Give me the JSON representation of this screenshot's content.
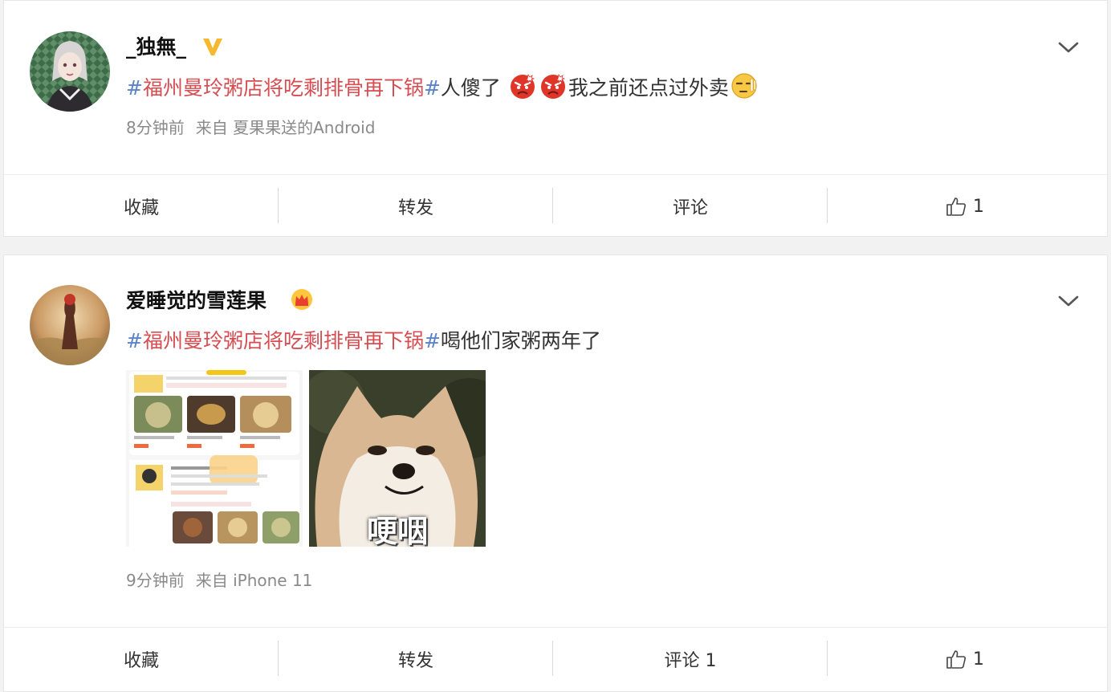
{
  "posts": [
    {
      "username": "_独無_",
      "badge_icon": "verified-v-icon",
      "text": {
        "hash_open": "#",
        "topic": "福州曼玲粥店将吃剩排骨再下锅",
        "hash_close": "#",
        "before_emoji": "人傻了",
        "after_emoji": "我之前还点过外卖"
      },
      "emojis": [
        "angry-face-icon",
        "angry-face-icon",
        "smirk-face-icon"
      ],
      "time": "8分钟前",
      "source": "来自 夏果果送的Android",
      "actions": {
        "favorite": "收藏",
        "repost": "转发",
        "comment": "评论",
        "like_count": "1"
      }
    },
    {
      "username": "爱睡觉的雪莲果",
      "badge_icon": "crown-icon",
      "text": {
        "hash_open": "#",
        "topic": "福州曼玲粥店将吃剩排骨再下锅",
        "hash_close": "#",
        "body": "喝他们家粥两年了"
      },
      "images": [
        {
          "name": "menu-screenshot-image"
        },
        {
          "name": "shiba-meme-image",
          "caption": "哽咽"
        }
      ],
      "time": "9分钟前",
      "source": "来自 iPhone 11",
      "actions": {
        "favorite": "收藏",
        "repost": "转发",
        "comment": "评论 1",
        "like_count": "1"
      }
    }
  ],
  "colors": {
    "topic": "#d64e52",
    "hash": "#5a83c8",
    "meta": "#8a8a8a",
    "background": "#f2f2f2"
  }
}
